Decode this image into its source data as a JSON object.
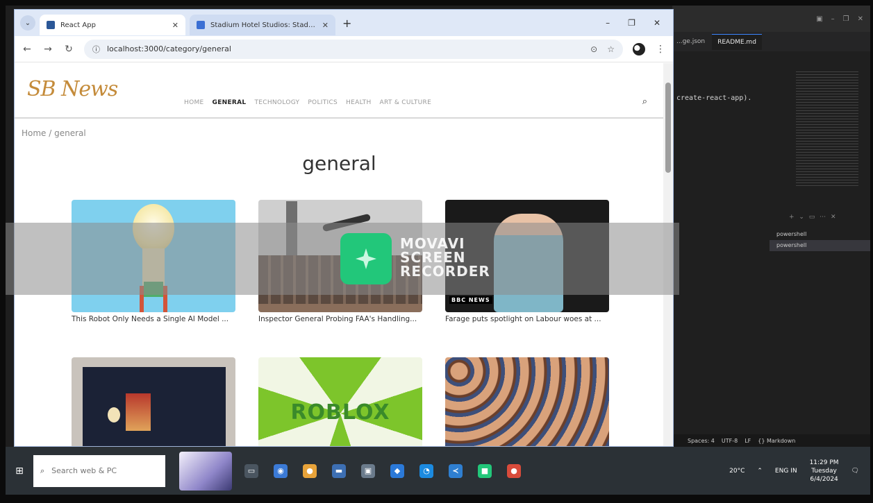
{
  "browser": {
    "tabs": [
      {
        "title": "React App",
        "active": true
      },
      {
        "title": "Stadium Hotel Studios: Stadium ...",
        "active": false
      }
    ],
    "url": "localhost:3000/category/general",
    "new_tab_symbol": "+",
    "tab_close_symbol": "✕"
  },
  "site": {
    "logo": "SB News",
    "nav": [
      "HOME",
      "GENERAL",
      "TECHNOLOGY",
      "POLITICS",
      "HEALTH",
      "ART & CULTURE"
    ],
    "active_nav": "GENERAL",
    "breadcrumb": "Home / general",
    "category_title": "general",
    "articles": [
      {
        "title": "This Robot Only Needs a Single AI Model ..."
      },
      {
        "title": "Inspector General Probing FAA's Handling..."
      },
      {
        "title": "Farage puts spotlight on Labour woes at ..."
      },
      {
        "title": ""
      },
      {
        "title": ""
      },
      {
        "title": ""
      }
    ],
    "thumb_text": {
      "bbc_badge": "BBC NEWS",
      "roblox": "ROBLOX"
    }
  },
  "overlay": {
    "lines": [
      "MOVAVI",
      "SCREEN",
      "RECORDER"
    ]
  },
  "vscode": {
    "tabs": [
      "...ge.json",
      "README.md"
    ],
    "code_line": "create-react-app).",
    "terminals": [
      "powershell",
      "powershell"
    ],
    "status": [
      "Spaces: 4",
      "UTF-8",
      "LF",
      "{} Markdown"
    ]
  },
  "taskbar": {
    "search_placeholder": "Search web & PC",
    "weather": "20°C",
    "language": "ENG IN",
    "time": "11:29 PM",
    "day": "Tuesday",
    "date": "6/4/2024"
  },
  "icons": [
    "back-arrow-icon",
    "forward-arrow-icon",
    "reload-icon",
    "info-icon",
    "lens-icon",
    "star-icon",
    "search-icon",
    "windows-start-icon"
  ],
  "colors": {
    "logo": "#c48b3a",
    "movavi": "#22c77a",
    "taskbar": "#2b3136"
  }
}
